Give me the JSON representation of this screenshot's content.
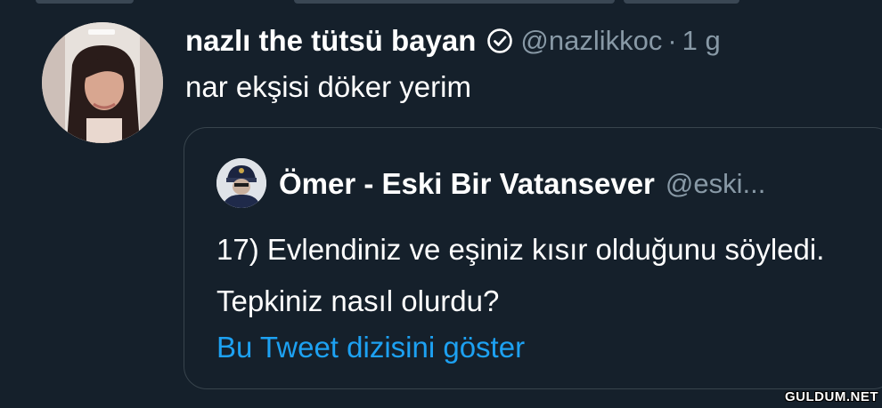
{
  "tweet": {
    "author_name": "nazlı the tütsü bayan",
    "handle": "@nazlikkoc",
    "separator": "·",
    "time": "1 g",
    "text": "nar ekşisi döker yerim",
    "verified_icon": "verified-badge-icon"
  },
  "quoted_tweet": {
    "author_name": "Ömer - Eski Bir Vatansever",
    "handle": "@eski...",
    "text": "17) Evlendiniz ve eşiniz kısır olduğunu söyledi. Tepkiniz nasıl olurdu?",
    "thread_link": "Bu Tweet dizisini göster"
  },
  "watermark": {
    "text": "GULDUM.NET"
  },
  "colors": {
    "background": "#15202b",
    "primary_text": "#ffffff",
    "secondary_text": "#8899a6",
    "link": "#1da1f2",
    "border": "#38444d"
  }
}
